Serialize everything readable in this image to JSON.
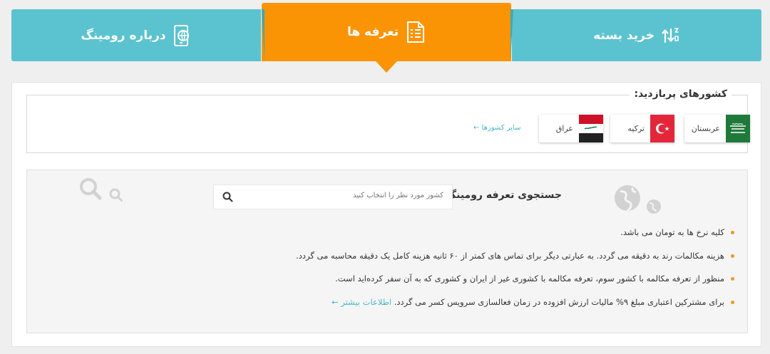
{
  "tabs": {
    "buy_package": "خرید بسته",
    "tariffs": "تعرفه ها",
    "about_roaming": "درباره رومینگ"
  },
  "popular": {
    "title": "کشورهای پربازدید:",
    "countries": [
      {
        "name": "عربستان"
      },
      {
        "name": "ترکیه"
      },
      {
        "name": "عراق"
      }
    ],
    "other_link": "سایر کشورها ←"
  },
  "search": {
    "label": "جستجوی تعرفه رومینگ",
    "placeholder": "کشور مورد نظر را انتخاب کنید"
  },
  "notes": [
    {
      "text": "کلیه نرخ ها به تومان می باشد."
    },
    {
      "text": "هزینه مکالمات رند به دقیقه می گردد. به عبارتی دیگر برای تماس های کمتر از ۶۰ ثانیه هزینه کامل یک دقیقه محاسبه می گردد."
    },
    {
      "text": "منظور از تعرفه مکالمه با کشور سوم، تعرفه مکالمه با کشوری غیر از ایران و کشوری که به آن سفر کرده‌اید است."
    },
    {
      "text": "برای مشترکین اعتباری مبلغ ۹% مالیات ارزش افزوده در زمان فعالسازی سرویس کسر می گردد.",
      "link": "اطلاعات بیشتر ←"
    }
  ],
  "colors": {
    "tab_blue": "#5bc3d0",
    "tab_orange": "#fb9404",
    "link": "#4bb8c8",
    "bullet": "#f0962a"
  }
}
